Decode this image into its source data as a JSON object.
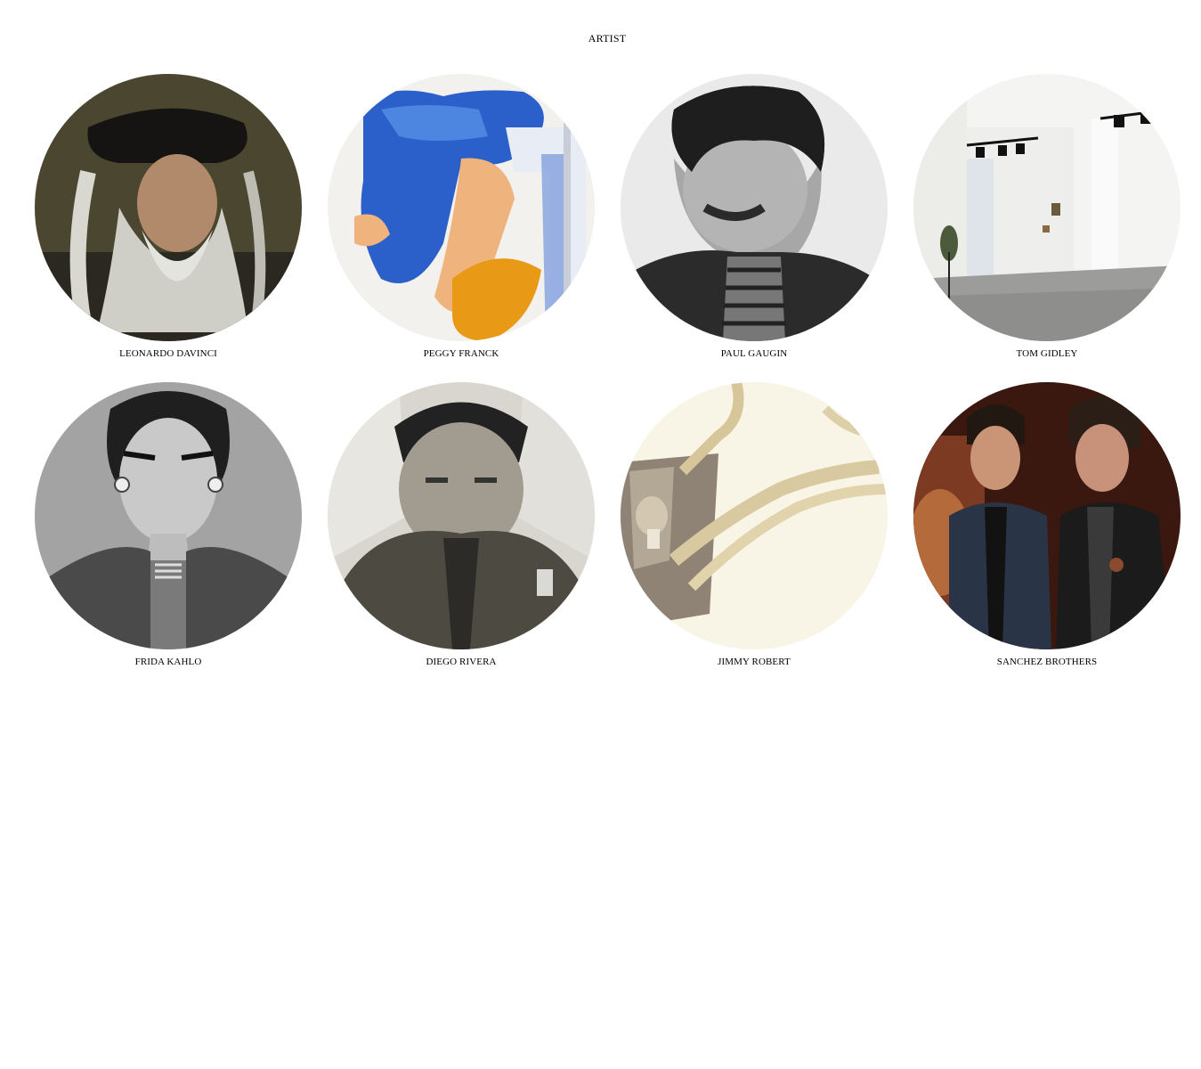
{
  "page": {
    "title": "ARTIST"
  },
  "artists": [
    {
      "name": "LEONARDO DAVINCI",
      "image": "leonardo-davinci-portrait"
    },
    {
      "name": "PEGGY FRANCK",
      "image": "peggy-franck-artwork"
    },
    {
      "name": "PAUL GAUGIN",
      "image": "paul-gaugin-portrait"
    },
    {
      "name": "TOM GIDLEY",
      "image": "tom-gidley-gallery"
    },
    {
      "name": "FRIDA KAHLO",
      "image": "frida-kahlo-portrait"
    },
    {
      "name": "DIEGO RIVERA",
      "image": "diego-rivera-portrait"
    },
    {
      "name": "JIMMY ROBERT",
      "image": "jimmy-robert-artwork"
    },
    {
      "name": "SANCHEZ BROTHERS",
      "image": "sanchez-brothers-portrait"
    }
  ]
}
